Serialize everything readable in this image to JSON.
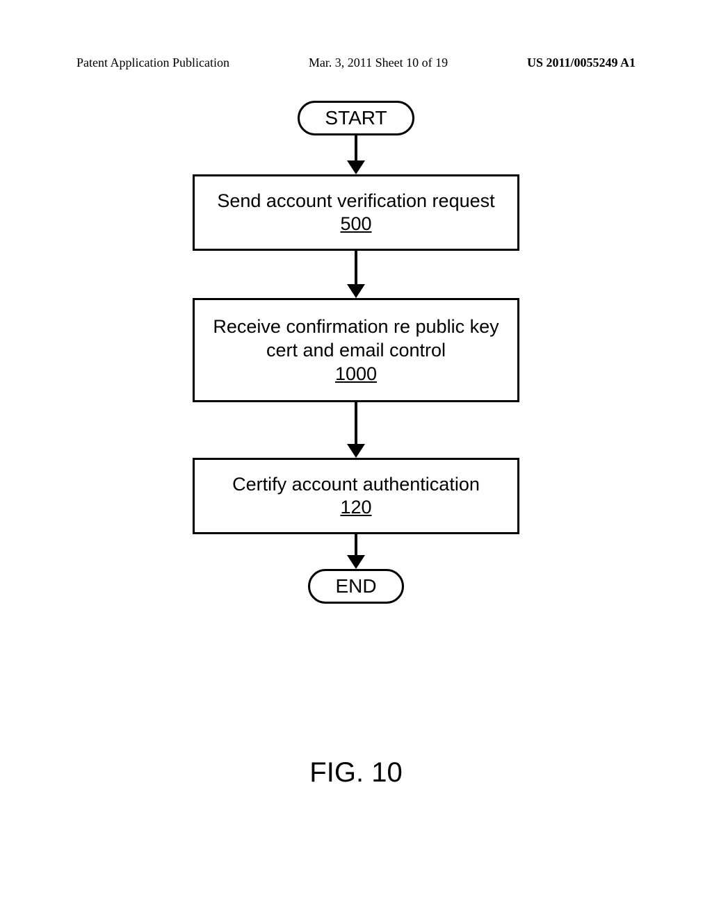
{
  "header": {
    "left": "Patent Application Publication",
    "center": "Mar. 3, 2011   Sheet 10 of 19",
    "right": "US 2011/0055249 A1"
  },
  "flow": {
    "start": "START",
    "step1": {
      "text": "Send account verification request",
      "ref": "500"
    },
    "step2": {
      "text": "Receive confirmation re public key cert and email control",
      "ref": "1000"
    },
    "step3": {
      "text": "Certify account authentication",
      "ref": "120"
    },
    "end": "END"
  },
  "caption": "FIG. 10",
  "chart_data": {
    "type": "flowchart",
    "nodes": [
      {
        "id": "start",
        "shape": "terminator",
        "label": "START"
      },
      {
        "id": "n1",
        "shape": "process",
        "label": "Send account verification request",
        "ref": "500"
      },
      {
        "id": "n2",
        "shape": "process",
        "label": "Receive confirmation re public key cert and email control",
        "ref": "1000"
      },
      {
        "id": "n3",
        "shape": "process",
        "label": "Certify account authentication",
        "ref": "120"
      },
      {
        "id": "end",
        "shape": "terminator",
        "label": "END"
      }
    ],
    "edges": [
      {
        "from": "start",
        "to": "n1"
      },
      {
        "from": "n1",
        "to": "n2"
      },
      {
        "from": "n2",
        "to": "n3"
      },
      {
        "from": "n3",
        "to": "end"
      }
    ]
  }
}
